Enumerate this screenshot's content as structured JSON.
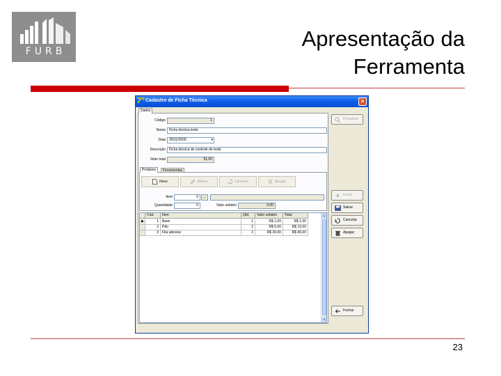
{
  "slide": {
    "logo_text": "FURB",
    "title_line1": "Apresentação da",
    "title_line2": "Ferramenta",
    "page_number": "23"
  },
  "colors": {
    "accent_red": "#cc0000",
    "logo_gray": "#8e8e8e",
    "titlebar_blue": "#0f5ee8"
  },
  "window": {
    "icon": "7°",
    "title": "Cadastro de Ficha Técnica",
    "close_label": "×",
    "outer_tab": "Dados",
    "fields": {
      "codigo_label": "Código",
      "codigo_value": "1",
      "nome_label": "Nome",
      "nome_value": "Ficha técnica teste",
      "data_label": "Data",
      "data_value": "20/11/2000",
      "descricao_label": "Descrição",
      "descricao_value": "Ficha técnica de controle de teste",
      "valor_total_label": "Valor total",
      "valor_total_value": "51,00"
    },
    "inner_tabs": [
      "Produtos",
      "Ferramentas"
    ],
    "toolbar": {
      "novo": "Novo",
      "alterar": "Alterar",
      "cancelar": "Cancelar",
      "apagar": "Apagar"
    },
    "item_fields": {
      "item_label": "Item",
      "item_value": "0",
      "item_button": "...",
      "quantidade_label": "Quantidade",
      "quantidade_value": "0",
      "valor_unitario_label": "Valor unitário",
      "valor_unitario_value": "0,00"
    },
    "grid": {
      "columns": [
        "Cód.",
        "Item",
        "Qtd.",
        "Valor unitário",
        "Total"
      ],
      "rows": [
        {
          "indicator": "▶",
          "cod": "1",
          "item": "Base",
          "qtd": "1",
          "unit": "R$ 1,00",
          "total": "R$ 1,00"
        },
        {
          "indicator": "",
          "cod": "2",
          "item": "Pão",
          "qtd": "2",
          "unit": "R$ 5,00",
          "total": "R$ 10,00"
        },
        {
          "indicator": "",
          "cod": "3",
          "item": "Fita adesiva",
          "qtd": "2",
          "unit": "R$ 20,00",
          "total": "R$ 40,00"
        }
      ]
    },
    "side_buttons": {
      "pesquisar": "Pesquisar",
      "incluir": "Incluir",
      "salvar": "Salvar",
      "cancelar": "Cancelar",
      "apagar": "Apagar",
      "fechar": "Fechar"
    }
  }
}
